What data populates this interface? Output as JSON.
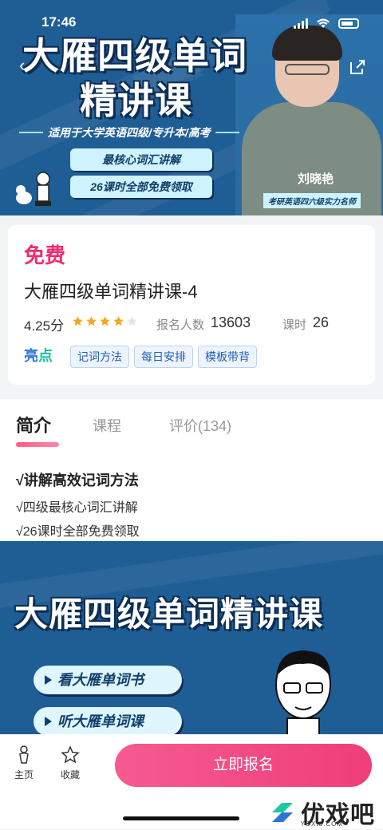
{
  "status_bar": {
    "time": "17:46"
  },
  "hero": {
    "title_line1": "大雁四级单词",
    "title_line2": "精讲课",
    "subtitle": "适用于大学英语四级/专升本/高考",
    "pill1": "最核心词汇讲解",
    "pill2": "26课时全部免费领取",
    "teacher_name": "刘晓艳",
    "teacher_title": "考研英语四六级实力名师"
  },
  "course": {
    "price": "免费",
    "name": "大雁四级单词精讲课-4",
    "rating": "4.25分",
    "stars_filled": 4,
    "stars_total": 5,
    "enroll_label": "报名人数",
    "enroll_count": "13603",
    "lesson_label": "课时",
    "lesson_count": "26",
    "highlight_label_a": "亮",
    "highlight_label_b": "点",
    "tags": [
      "记词方法",
      "每日安排",
      "模板带背"
    ]
  },
  "tabs": [
    {
      "label": "简介"
    },
    {
      "label": "课程"
    },
    {
      "label": "评价(134)"
    }
  ],
  "intro": [
    "√讲解高效记词方法",
    "√四级最核心词汇讲解",
    "√26课时全部免费领取"
  ],
  "banner": {
    "title": "大雁四级单词精讲课",
    "pill1": "看大雁单词书",
    "pill2": "听大雁单词课"
  },
  "bottom_bar": {
    "home_label": "主页",
    "fav_label": "收藏",
    "signup_label": "立即报名"
  },
  "watermark": {
    "text": "优戏吧",
    "sub": "YOXI8.COM"
  },
  "colors": {
    "accent": "#ef3e7a",
    "hero_blue": "#1f5d95",
    "star": "#f5a623"
  }
}
